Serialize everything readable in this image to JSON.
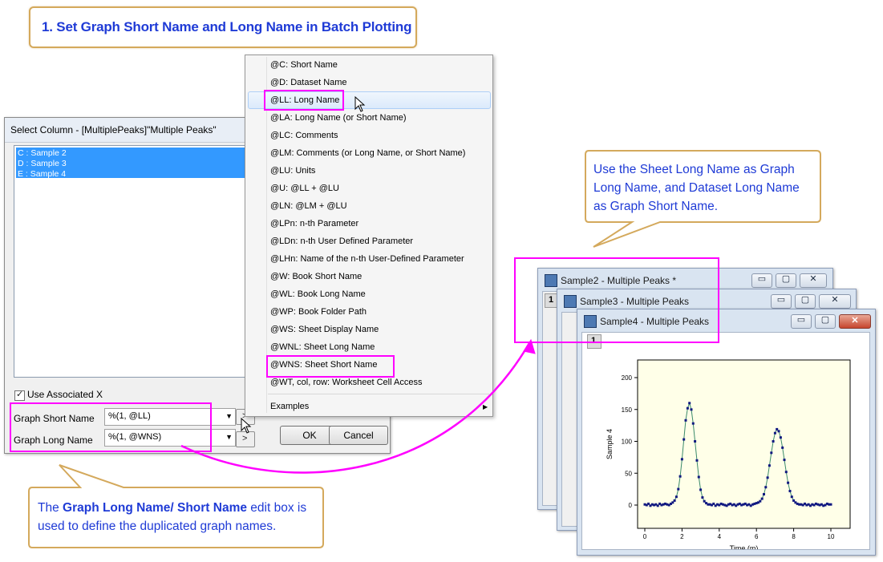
{
  "title_callout": "1. Set Graph Short Name and Long Name in Batch Plotting",
  "dialog": {
    "title": "Select Column - [MultiplePeaks]\"Multiple Peaks\"",
    "columns": [
      "C : Sample 2",
      "D : Sample 3",
      "E : Sample 4"
    ],
    "use_associated_x": "Use Associated X",
    "graph_short_name_label": "Graph Short Name",
    "graph_short_name_value": "%(1, @LL)",
    "graph_long_name_label": "Graph Long Name",
    "graph_long_name_value": "%(1, @WNS)",
    "arrow_button": ">",
    "ok_label": "OK",
    "cancel_label": "Cancel"
  },
  "menu": {
    "items": [
      "@C: Short Name",
      "@D: Dataset Name",
      "@LL: Long Name",
      "@LA: Long Name (or Short Name)",
      "@LC: Comments",
      "@LM: Comments (or Long Name, or Short Name)",
      "@LU: Units",
      "@U: @LL + @LU",
      "@LN: @LM + @LU",
      "@LPn: n-th Parameter",
      "@LDn: n-th User Defined Parameter",
      "@LHn: Name of the n-th User-Defined Parameter",
      "@W: Book Short Name",
      "@WL: Book Long Name",
      "@WP: Book Folder Path",
      "@WS: Sheet Display Name",
      "@WNL: Sheet Long Name",
      "@WNS: Sheet Short Name",
      "@WT, col, row: Worksheet Cell Access"
    ],
    "examples": "Examples"
  },
  "right_callout": [
    "Use the Sheet Long Name as Graph",
    "Long Name, and Dataset Long Name",
    "as Graph Short Name."
  ],
  "bottom_callout": {
    "prefix": "The ",
    "bold": "Graph Long Name/ Short Name",
    "suffix": " edit box is",
    "line2": "used to define the duplicated graph names."
  },
  "windows": [
    {
      "title": "Sample2 - Multiple Peaks *"
    },
    {
      "title": "Sample3 - Multiple Peaks"
    },
    {
      "title": "Sample4 - Multiple Peaks"
    }
  ],
  "layer_number": "1",
  "window_buttons": {
    "minimize": "▭",
    "restore": "▢",
    "close": "✕"
  },
  "chart_data": {
    "type": "scatter",
    "xlabel": "Time (m)",
    "ylabel": "Sample 4",
    "xlim": [
      0,
      10
    ],
    "ylim": [
      0,
      200
    ],
    "x_ticks": [
      "0",
      "2",
      "4",
      "6",
      "8",
      "10"
    ],
    "y_ticks": [
      "0",
      "50",
      "100",
      "150",
      "200"
    ],
    "series": [
      {
        "x": [
          0.0,
          0.1,
          0.2,
          0.3,
          0.4,
          0.5,
          0.6,
          0.7,
          0.8,
          0.9,
          1.0,
          1.1,
          1.2,
          1.3,
          1.4,
          1.5,
          1.6,
          1.7,
          1.8,
          1.9,
          2.0,
          2.1,
          2.2,
          2.3,
          2.4,
          2.5,
          2.6,
          2.7,
          2.8,
          2.9,
          3.0,
          3.1,
          3.2,
          3.3,
          3.4,
          3.5,
          3.6,
          3.7,
          3.8,
          3.9,
          4.0,
          4.1,
          4.2,
          4.3,
          4.4,
          4.5,
          4.6,
          4.7,
          4.8,
          4.9,
          5.0,
          5.1,
          5.2,
          5.3,
          5.4,
          5.5,
          5.6,
          5.7,
          5.8,
          5.9,
          6.0,
          6.1,
          6.2,
          6.3,
          6.4,
          6.5,
          6.6,
          6.7,
          6.8,
          6.9,
          7.0,
          7.1,
          7.2,
          7.3,
          7.4,
          7.5,
          7.6,
          7.7,
          7.8,
          7.9,
          8.0,
          8.1,
          8.2,
          8.3,
          8.4,
          8.5,
          8.6,
          8.7,
          8.8,
          8.9,
          9.0,
          9.1,
          9.2,
          9.3,
          9.4,
          9.5,
          9.6,
          9.7,
          9.8,
          9.9,
          10.0
        ],
        "y": [
          1,
          0,
          2,
          -1,
          1,
          0,
          1,
          -1,
          2,
          0,
          1,
          2,
          1,
          0,
          2,
          4,
          7,
          13,
          25,
          45,
          72,
          103,
          133,
          152,
          160,
          150,
          128,
          100,
          70,
          44,
          24,
          12,
          6,
          3,
          1,
          1,
          0,
          2,
          -1,
          1,
          0,
          2,
          1,
          0,
          -1,
          1,
          2,
          0,
          1,
          -1,
          1,
          2,
          0,
          1,
          2,
          0,
          1,
          -1,
          1,
          2,
          3,
          4,
          6,
          10,
          17,
          28,
          43,
          62,
          82,
          100,
          113,
          119,
          116,
          106,
          90,
          71,
          52,
          35,
          22,
          13,
          7,
          4,
          2,
          1,
          1,
          0,
          2,
          0,
          1,
          -1,
          1,
          0,
          2,
          1,
          0,
          1,
          -1,
          0,
          2,
          1,
          1
        ]
      }
    ]
  }
}
